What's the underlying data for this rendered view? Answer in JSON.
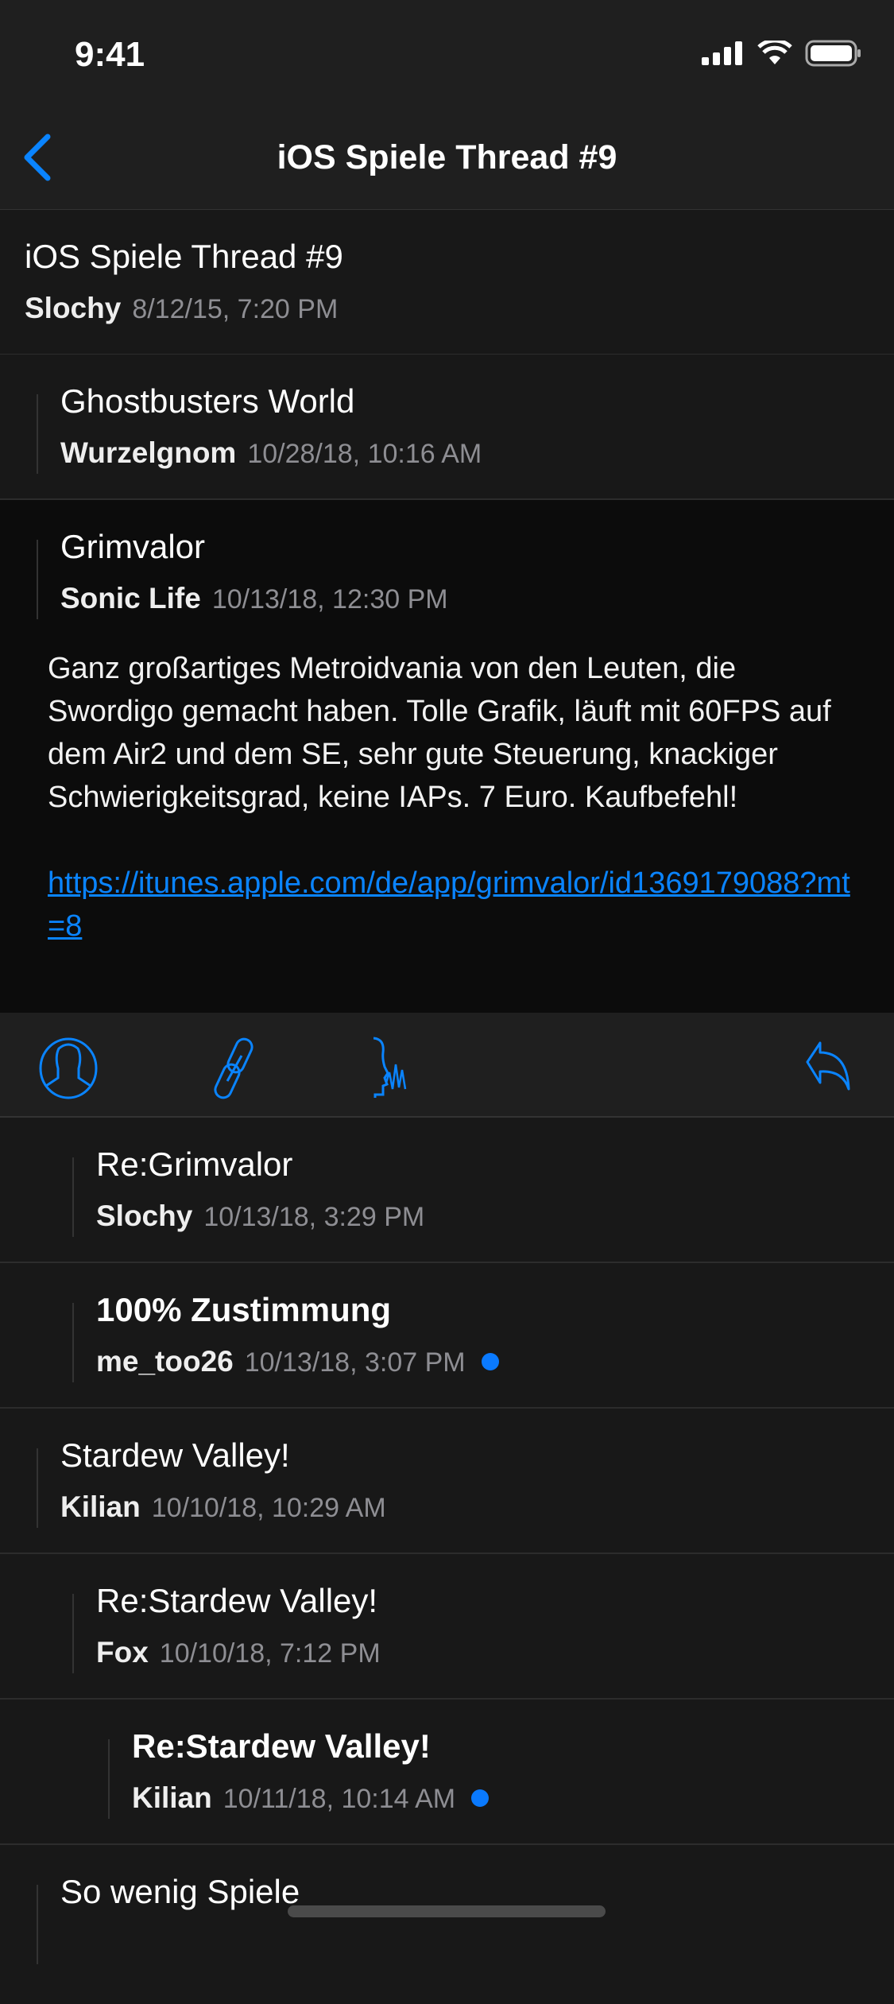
{
  "status": {
    "time": "9:41"
  },
  "nav": {
    "title": "iOS Spiele Thread #9"
  },
  "rows": [
    {
      "title": "iOS Spiele Thread #9",
      "author": "Slochy",
      "date": "8/12/15, 7:20 PM",
      "level": 0,
      "unread": false
    },
    {
      "title": "Ghostbusters World",
      "author": "Wurzelgnom",
      "date": "10/28/18, 10:16 AM",
      "level": 1,
      "unread": false
    },
    {
      "title": "Grimvalor",
      "author": "Sonic Life",
      "date": "10/13/18, 12:30 PM",
      "level": 1,
      "unread": false
    },
    {
      "title": "Re:Grimvalor",
      "author": "Slochy",
      "date": "10/13/18, 3:29 PM",
      "level": 2,
      "unread": false
    },
    {
      "title": "100% Zustimmung",
      "author": "me_too26",
      "date": "10/13/18, 3:07 PM",
      "level": 2,
      "unread": true
    },
    {
      "title": "Stardew Valley!",
      "author": "Kilian",
      "date": "10/10/18, 10:29 AM",
      "level": 1,
      "unread": false
    },
    {
      "title": "Re:Stardew Valley!",
      "author": "Fox",
      "date": "10/10/18, 7:12 PM",
      "level": 2,
      "unread": false
    },
    {
      "title": "Re:Stardew Valley!",
      "author": "Kilian",
      "date": "10/11/18, 10:14 AM",
      "level": 3,
      "unread": true
    },
    {
      "title": "So wenig Spiele",
      "level": 1
    }
  ],
  "post": {
    "body": "Ganz großartiges Metroidvania von den Leuten, die Swordigo gemacht haben. Tolle Grafik, läuft mit 60FPS auf dem Air2 und dem SE, sehr gute Steuerung, knackiger Schwierigkeitsgrad, keine IAPs. 7 Euro. Kaufbefehl!",
    "link": "https://itunes.apple.com/de/app/grimvalor/id1369179088?mt=8"
  },
  "toolbar": {
    "icons": [
      "profile-icon",
      "link-icon",
      "speak-icon",
      "reply-icon"
    ]
  },
  "colors": {
    "accent": "#0a84ff",
    "unread_dot": "#0a7aff",
    "background": "#181818",
    "selected": "#0c0c0c"
  }
}
